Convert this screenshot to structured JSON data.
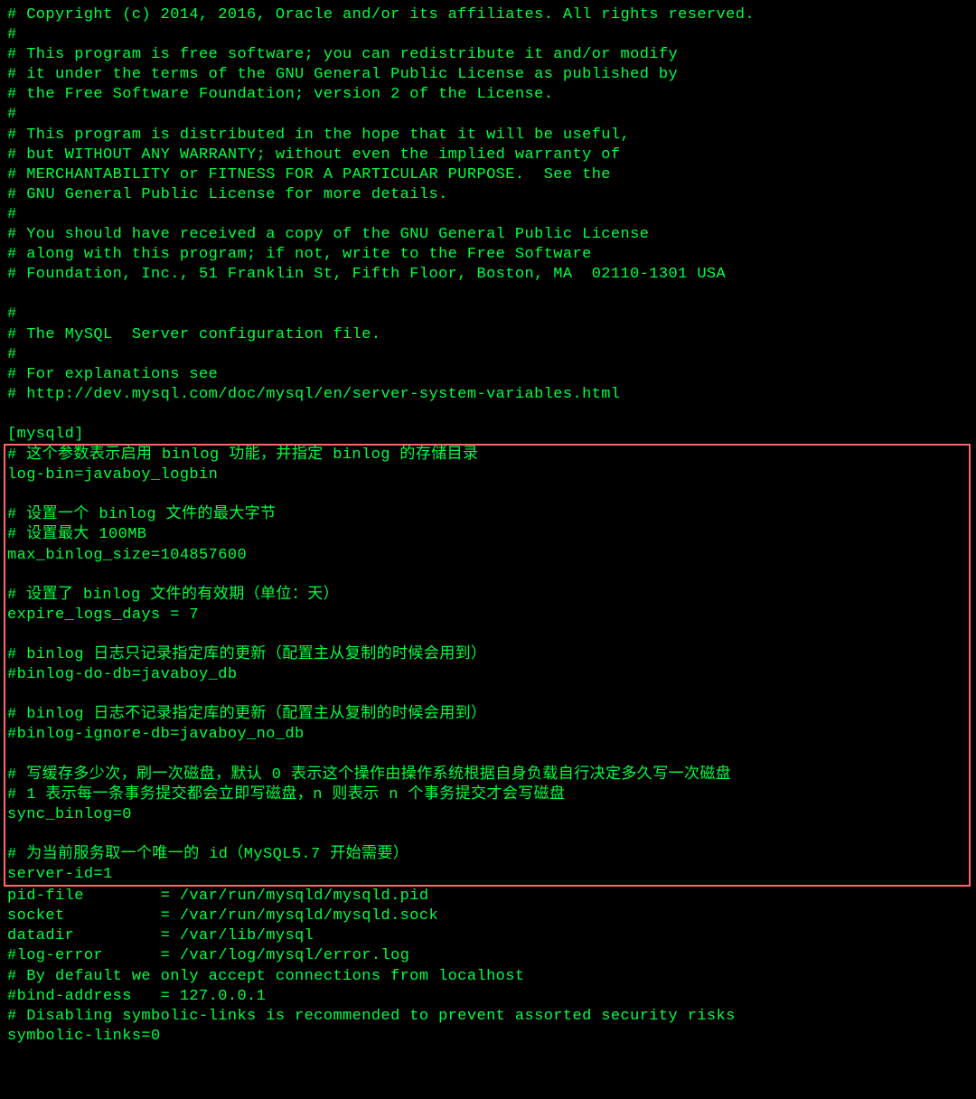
{
  "header": {
    "lines": [
      "# Copyright (c) 2014, 2016, Oracle and/or its affiliates. All rights reserved.",
      "#",
      "# This program is free software; you can redistribute it and/or modify",
      "# it under the terms of the GNU General Public License as published by",
      "# the Free Software Foundation; version 2 of the License.",
      "#",
      "# This program is distributed in the hope that it will be useful,",
      "# but WITHOUT ANY WARRANTY; without even the implied warranty of",
      "# MERCHANTABILITY or FITNESS FOR A PARTICULAR PURPOSE.  See the",
      "# GNU General Public License for more details.",
      "#",
      "# You should have received a copy of the GNU General Public License",
      "# along with this program; if not, write to the Free Software",
      "# Foundation, Inc., 51 Franklin St, Fifth Floor, Boston, MA  02110-1301 USA",
      "",
      "#",
      "# The MySQL  Server configuration file.",
      "#",
      "# For explanations see",
      "# http://dev.mysql.com/doc/mysql/en/server-system-variables.html",
      "",
      "[mysqld]"
    ]
  },
  "highlighted": {
    "lines": [
      "# 这个参数表示启用 binlog 功能，并指定 binlog 的存储目录",
      "log-bin=javaboy_logbin",
      "",
      "# 设置一个 binlog 文件的最大字节",
      "# 设置最大 100MB",
      "max_binlog_size=104857600",
      "",
      "# 设置了 binlog 文件的有效期（单位：天）",
      "expire_logs_days = 7",
      "",
      "# binlog 日志只记录指定库的更新（配置主从复制的时候会用到）",
      "#binlog-do-db=javaboy_db",
      "",
      "# binlog 日志不记录指定库的更新（配置主从复制的时候会用到）",
      "#binlog-ignore-db=javaboy_no_db",
      "",
      "# 写缓存多少次，刷一次磁盘，默认 0 表示这个操作由操作系统根据自身负载自行决定多久写一次磁盘",
      "# 1 表示每一条事务提交都会立即写磁盘，n 则表示 n 个事务提交才会写磁盘",
      "sync_binlog=0",
      "",
      "# 为当前服务取一个唯一的 id（MySQL5.7 开始需要）",
      "server-id=1"
    ]
  },
  "footer": {
    "lines": [
      "pid-file        = /var/run/mysqld/mysqld.pid",
      "socket          = /var/run/mysqld/mysqld.sock",
      "datadir         = /var/lib/mysql",
      "#log-error      = /var/log/mysql/error.log",
      "# By default we only accept connections from localhost",
      "#bind-address   = 127.0.0.1",
      "# Disabling symbolic-links is recommended to prevent assorted security risks",
      "symbolic-links=0"
    ]
  }
}
